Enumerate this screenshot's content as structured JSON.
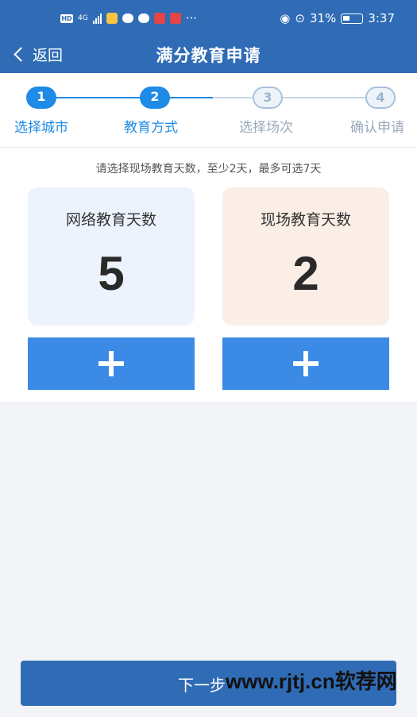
{
  "status": {
    "battery": "31%",
    "time": "3:37",
    "network": "4G",
    "more": "···"
  },
  "header": {
    "back_label": "返回",
    "title": "满分教育申请"
  },
  "steps": [
    {
      "number": "1",
      "label": "选择城市",
      "state": "done"
    },
    {
      "number": "2",
      "label": "教育方式",
      "state": "done"
    },
    {
      "number": "3",
      "label": "选择场次",
      "state": "todo"
    },
    {
      "number": "4",
      "label": "确认申请",
      "state": "todo"
    }
  ],
  "main": {
    "hint": "请选择现场教育天数，至少2天，最多可选7天",
    "online": {
      "label": "网络教育天数",
      "value": "5"
    },
    "onsite": {
      "label": "现场教育天数",
      "value": "2"
    }
  },
  "footer": {
    "next_label": "下一步"
  },
  "watermark": "www.rjtj.cn软荐网",
  "colors": {
    "primary": "#2f6cb5",
    "accent": "#1e8be6",
    "button": "#3b8ae6",
    "online_card": "#edf3fc",
    "onsite_card": "#fbeee6"
  }
}
